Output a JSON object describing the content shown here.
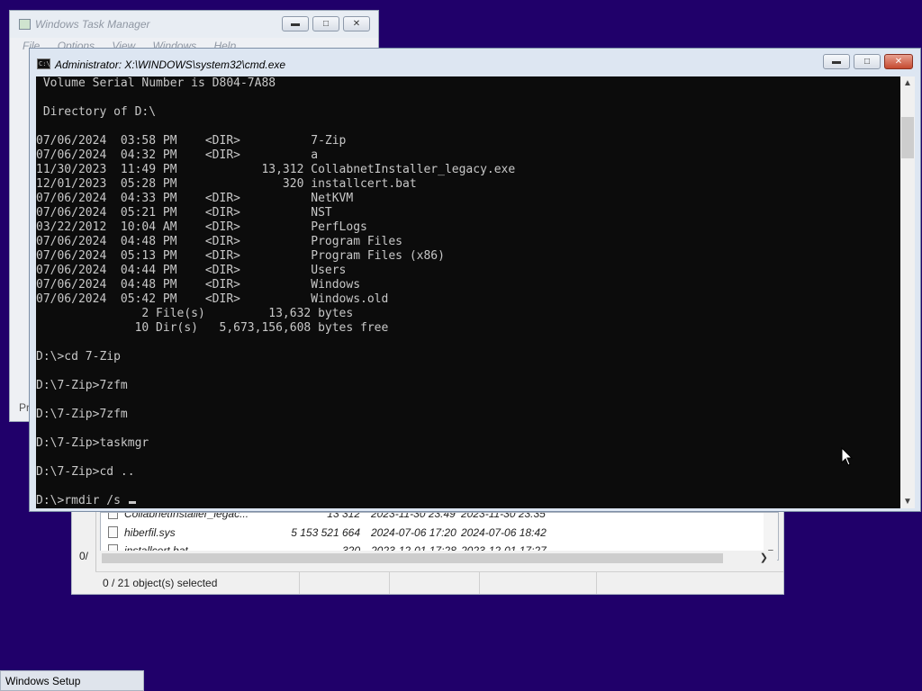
{
  "task_manager": {
    "title": "Windows Task Manager",
    "menu": [
      "File",
      "Options",
      "View",
      "Windows",
      "Help"
    ],
    "left_text": "Pr"
  },
  "file_manager": {
    "left_text": "0/",
    "rows": [
      {
        "name": "CollabnetInstaller_legac...",
        "size": "13 312",
        "modified": "2023-11-30 23:49",
        "created": "2023-11-30 23:35"
      },
      {
        "name": "hiberfil.sys",
        "size": "5 153 521 664",
        "modified": "2024-07-06 17:20",
        "created": "2024-07-06 18:42"
      },
      {
        "name": "installcert.bat",
        "size": "320",
        "modified": "2023-12-01 17:28",
        "created": "2023-12-01 17:27"
      }
    ],
    "status": "0 / 21 object(s) selected"
  },
  "cmd": {
    "title": "Administrator: X:\\WINDOWS\\system32\\cmd.exe",
    "icon_text": "C:\\",
    "output": " Volume Serial Number is D804-7A88\n\n Directory of D:\\\n\n07/06/2024  03:58 PM    <DIR>          7-Zip\n07/06/2024  04:32 PM    <DIR>          a\n11/30/2023  11:49 PM            13,312 CollabnetInstaller_legacy.exe\n12/01/2023  05:28 PM               320 installcert.bat\n07/06/2024  04:33 PM    <DIR>          NetKVM\n07/06/2024  05:21 PM    <DIR>          NST\n03/22/2012  10:04 AM    <DIR>          PerfLogs\n07/06/2024  04:48 PM    <DIR>          Program Files\n07/06/2024  05:13 PM    <DIR>          Program Files (x86)\n07/06/2024  04:44 PM    <DIR>          Users\n07/06/2024  04:48 PM    <DIR>          Windows\n07/06/2024  05:42 PM    <DIR>          Windows.old\n               2 File(s)         13,632 bytes\n              10 Dir(s)   5,673,156,608 bytes free\n\nD:\\>cd 7-Zip\n\nD:\\7-Zip>7zfm\n\nD:\\7-Zip>7zfm\n\nD:\\7-Zip>taskmgr\n\nD:\\7-Zip>cd ..\n\n",
    "prompt_line": "D:\\>rmdir /s "
  },
  "taskbar": {
    "setup_label": "Windows Setup"
  },
  "colors": {
    "desktop": "#20006a",
    "console_bg": "#0c0c0c",
    "console_fg": "#c8c8c8"
  },
  "icons": {
    "minimize": "minimize-icon",
    "maximize": "maximize-icon",
    "close": "close-icon",
    "pointer": "mouse-pointer-icon"
  }
}
